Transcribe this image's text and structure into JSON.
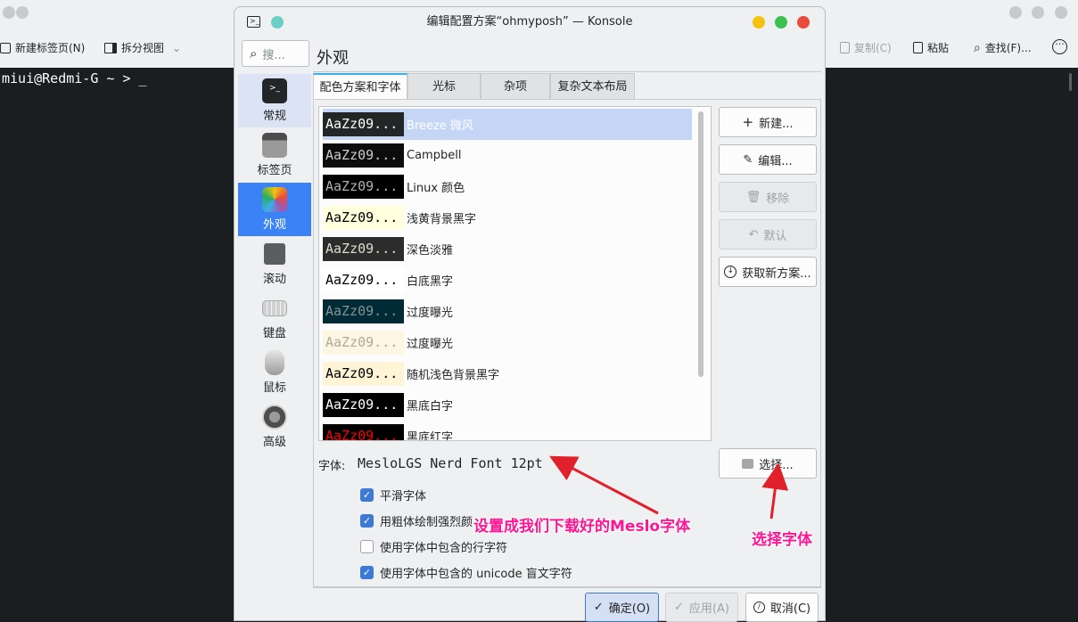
{
  "konsole": {
    "toolbar": {
      "new_tab": "新建标签页(N)",
      "split_view": "拆分视图",
      "copy": "复制(C)",
      "paste": "粘贴",
      "find": "查找(F)..."
    },
    "prompt": "miui@Redmi-G ~ > _"
  },
  "dialog": {
    "title": "编辑配置方案“ohmyposh” — Konsole",
    "search_placeholder": "搜...",
    "sidebar": [
      {
        "label": "常规",
        "icon": "terminal-icon"
      },
      {
        "label": "标签页",
        "icon": "tabs-icon"
      },
      {
        "label": "外观",
        "icon": "appearance-icon"
      },
      {
        "label": "滚动",
        "icon": "scroll-icon"
      },
      {
        "label": "键盘",
        "icon": "keyboard-icon"
      },
      {
        "label": "鼠标",
        "icon": "mouse-icon"
      },
      {
        "label": "高级",
        "icon": "advanced-icon"
      }
    ],
    "page_title": "外观",
    "tabs": [
      "配色方案和字体",
      "光标",
      "杂项",
      "复杂文本布局"
    ],
    "preview_text": "AaZz09...",
    "schemes": [
      {
        "name": "Breeze 微风",
        "bg": "#232627",
        "fg": "#fcfcfc"
      },
      {
        "name": "Campbell",
        "bg": "#0c0c0c",
        "fg": "#cccccc"
      },
      {
        "name": "Linux 颜色",
        "bg": "#000000",
        "fg": "#b2b2b2"
      },
      {
        "name": "浅黄背景黑字",
        "bg": "#ffffdd",
        "fg": "#000000"
      },
      {
        "name": "深色淡雅",
        "bg": "#2c2c2c",
        "fg": "#dcdccc"
      },
      {
        "name": "白底黑字",
        "bg": "#ffffff",
        "fg": "#000000"
      },
      {
        "name": "过度曝光",
        "bg": "#002b36",
        "fg": "#839496"
      },
      {
        "name": "过度曝光",
        "bg": "#fdf6e3",
        "fg": "#b0aa98"
      },
      {
        "name": "随机浅色背景黑字",
        "bg": "#fff5d6",
        "fg": "#000000"
      },
      {
        "name": "黑底白字",
        "bg": "#000000",
        "fg": "#ffffff"
      },
      {
        "name": "黑底红字",
        "bg": "#000000",
        "fg": "#ff0000"
      }
    ],
    "buttons": {
      "new": "新建...",
      "edit": "编辑...",
      "remove": "移除",
      "default": "默认",
      "get_new": "获取新方案...",
      "choose": "选择..."
    },
    "font_label": "字体:",
    "font_value": "MesloLGS Nerd Font 12pt",
    "checkboxes": [
      {
        "label": "平滑字体",
        "checked": true
      },
      {
        "label": "用粗体绘制强烈颜",
        "checked": true
      },
      {
        "label": "使用字体中包含的行字符",
        "checked": false
      },
      {
        "label": "使用字体中包含的 unicode 盲文字符",
        "checked": true
      }
    ],
    "footer": {
      "ok": "确定(O)",
      "apply": "应用(A)",
      "cancel": "取消(C)"
    }
  },
  "annotations": {
    "font_note": "设置成我们下载好的Meslo字体",
    "choose_note": "选择字体"
  },
  "colors": {
    "accent": "#3daee9",
    "selected_sidebar": "#3b82f6",
    "annotation": "#ff1493"
  }
}
